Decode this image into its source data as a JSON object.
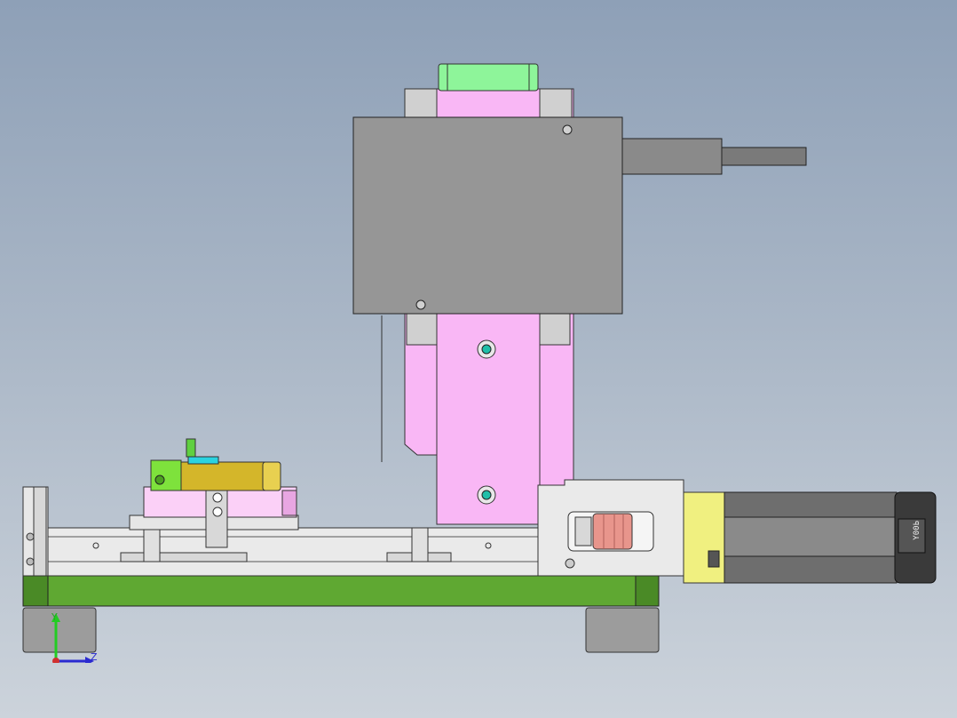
{
  "viewport": {
    "background_top": "#8ea0b7",
    "background_bottom": "#ccd3db"
  },
  "colors": {
    "pink": "#f9b7f5",
    "green_base": "#5fa832",
    "light_green": "#8ef59a",
    "gray_box": "#969696",
    "yellow": "#d4b62a",
    "yellow_light": "#f0f080",
    "lime": "#7ee23c",
    "cyan": "#2ad3e0",
    "salmon": "#e8958c",
    "dark": "#555555"
  },
  "motor": {
    "label": "Y00Ь"
  },
  "triad": {
    "y_label": "Y",
    "z_label": "Z"
  }
}
